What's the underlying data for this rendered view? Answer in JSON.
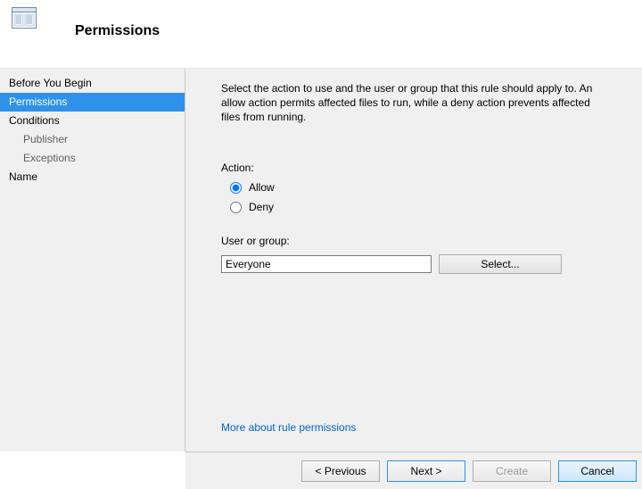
{
  "header": {
    "title": "Permissions"
  },
  "sidebar": {
    "items": [
      {
        "label": "Before You Begin"
      },
      {
        "label": "Permissions"
      },
      {
        "label": "Conditions"
      },
      {
        "label": "Publisher"
      },
      {
        "label": "Exceptions"
      },
      {
        "label": "Name"
      }
    ]
  },
  "content": {
    "description": "Select the action to use and the user or group that this rule should apply to. An allow action permits affected files to run, while a deny action prevents affected files from running.",
    "action_label": "Action:",
    "allow_label": "Allow",
    "deny_label": "Deny",
    "user_group_label": "User or group:",
    "user_group_value": "Everyone",
    "select_button": "Select...",
    "help_link": "More about rule permissions"
  },
  "footer": {
    "previous": "< Previous",
    "next": "Next >",
    "create": "Create",
    "cancel": "Cancel"
  }
}
